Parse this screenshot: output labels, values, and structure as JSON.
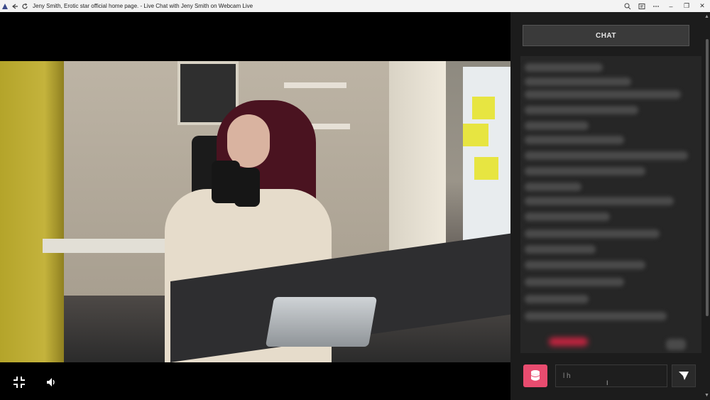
{
  "titlebar": {
    "title": "Jeny Smith, Erotic star official home page. - Live Chat with Jeny Smith on Webcam Live",
    "icons": [
      "app-icon",
      "back-icon",
      "refresh-icon",
      "zoom-icon",
      "reader-icon",
      "more-icon"
    ],
    "window_controls": {
      "minimize": "–",
      "restore": "❐",
      "close": "✕"
    }
  },
  "video": {
    "controls": {
      "exit_fullscreen_glyph": "⤡",
      "volume_glyph": "🔊"
    }
  },
  "chat": {
    "header_label": "CHAT",
    "input_value": "l h",
    "cursor_glyph": "I",
    "token_icon": "coins-icon",
    "send_icon": "send-icon"
  },
  "colors": {
    "accent": "#e84c6f",
    "panel_bg": "#1c1c1c",
    "titlebar_bg": "#f3f3f3"
  }
}
